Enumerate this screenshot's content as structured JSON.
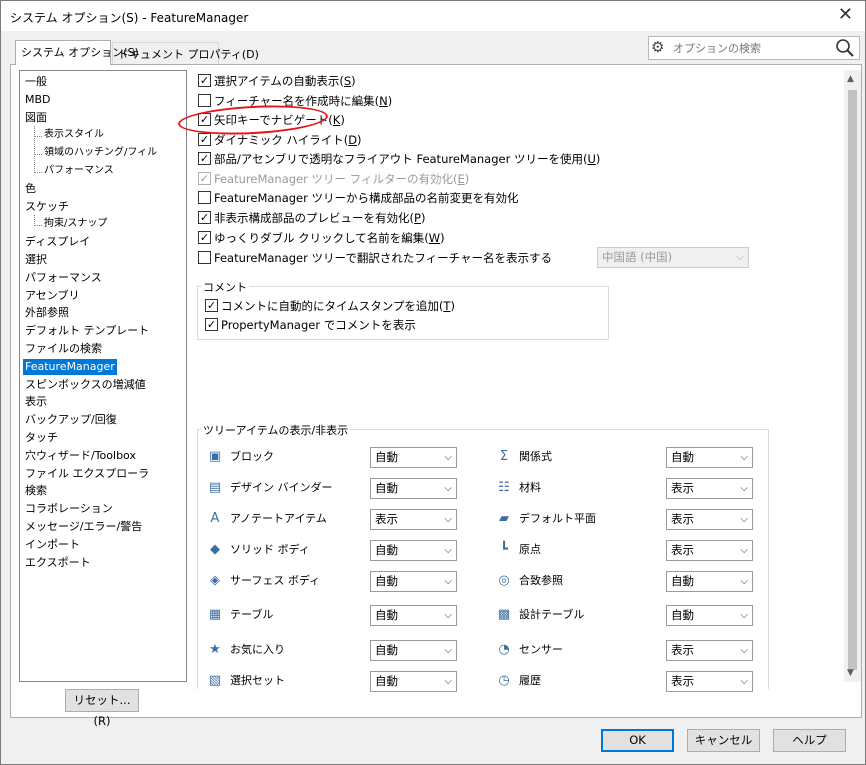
{
  "window": {
    "title": "システム オプション(S) - FeatureManager",
    "close_glyph": "✕"
  },
  "tabs": [
    {
      "label": "システム オプション(S)",
      "active": true
    },
    {
      "label": "ドキュメント プロパティ(D)",
      "active": false
    }
  ],
  "search": {
    "placeholder": "オプションの検索"
  },
  "tree": {
    "items": [
      {
        "label": "一般"
      },
      {
        "label": "MBD"
      },
      {
        "label": "図面"
      },
      {
        "label": "表示スタイル",
        "sub": true
      },
      {
        "label": "領域のハッチング/フィル",
        "sub": true
      },
      {
        "label": "パフォーマンス",
        "sub": true
      },
      {
        "label": "色"
      },
      {
        "label": "スケッチ"
      },
      {
        "label": "拘束/スナップ",
        "sub": true
      },
      {
        "label": "ディスプレイ"
      },
      {
        "label": "選択"
      },
      {
        "label": "パフォーマンス"
      },
      {
        "label": "アセンブリ"
      },
      {
        "label": "外部参照"
      },
      {
        "label": "デフォルト テンプレート"
      },
      {
        "label": "ファイルの検索"
      },
      {
        "label": "FeatureManager",
        "selected": true
      },
      {
        "label": "スピンボックスの増減値"
      },
      {
        "label": "表示"
      },
      {
        "label": "バックアップ/回復"
      },
      {
        "label": "タッチ"
      },
      {
        "label": "穴ウィザード/Toolbox"
      },
      {
        "label": "ファイル エクスプローラ"
      },
      {
        "label": "検索"
      },
      {
        "label": "コラボレーション"
      },
      {
        "label": "メッセージ/エラー/警告"
      },
      {
        "label": "インポート"
      },
      {
        "label": "エクスポート"
      }
    ]
  },
  "options": [
    {
      "label": "選択アイテムの自動表示(",
      "key": "S",
      "tail": ")",
      "checked": true
    },
    {
      "label": "フィーチャー名を作成時に編集(",
      "key": "N",
      "tail": ")",
      "checked": false
    },
    {
      "label": "矢印キーでナビゲート(",
      "key": "K",
      "tail": ")",
      "checked": true
    },
    {
      "label": "ダイナミック ハイライト(",
      "key": "D",
      "tail": ")",
      "checked": true
    },
    {
      "label": "部品/アセンブリで透明なフライアウト FeatureManager ツリーを使用(",
      "key": "U",
      "tail": ")",
      "checked": true
    },
    {
      "label": "FeatureManager ツリー フィルターの有効化(",
      "key": "E",
      "tail": ")",
      "checked": true,
      "disabled": true
    },
    {
      "label": "FeatureManager ツリーから構成部品の名前変更を有効化",
      "key": "",
      "tail": "",
      "checked": false
    },
    {
      "label": "非表示構成部品のプレビューを有効化(",
      "key": "P",
      "tail": ")",
      "checked": true
    },
    {
      "label": "ゆっくりダブル クリックして名前を編集(",
      "key": "W",
      "tail": ")",
      "checked": true
    },
    {
      "label": "FeatureManager ツリーで翻訳されたフィーチャー名を表示する",
      "key": "",
      "tail": "",
      "checked": false
    }
  ],
  "language_select": {
    "value": "中国語 (中国)",
    "disabled": true
  },
  "comment_group": {
    "title": "コメント",
    "options": [
      {
        "label": "コメントに自動的にタイムスタンプを追加(",
        "key": "T",
        "tail": ")",
        "checked": true
      },
      {
        "label": "PropertyManager でコメントを表示",
        "key": "",
        "tail": "",
        "checked": true
      }
    ]
  },
  "tree_items_group": {
    "title": "ツリーアイテムの表示/非表示",
    "left": [
      {
        "label": "ブロック",
        "value": "自動",
        "icon": "block-icon"
      },
      {
        "label": "デザイン バインダー",
        "value": "自動",
        "icon": "design-binder-icon"
      },
      {
        "label": "アノテートアイテム",
        "value": "表示",
        "icon": "annotation-icon"
      },
      {
        "label": "ソリッド ボディ",
        "value": "自動",
        "icon": "solid-body-icon"
      },
      {
        "label": "サーフェス ボディ",
        "value": "自動",
        "icon": "surface-body-icon"
      },
      {
        "label": "テーブル",
        "value": "自動",
        "icon": "table-icon"
      },
      {
        "label": "お気に入り",
        "value": "自動",
        "icon": "favorites-icon"
      },
      {
        "label": "選択セット",
        "value": "自動",
        "icon": "selection-set-icon"
      }
    ],
    "right": [
      {
        "label": "関係式",
        "value": "自動",
        "icon": "equations-icon"
      },
      {
        "label": "材料",
        "value": "表示",
        "icon": "material-icon"
      },
      {
        "label": "デフォルト平面",
        "value": "表示",
        "icon": "default-plane-icon"
      },
      {
        "label": "原点",
        "value": "表示",
        "icon": "origin-icon"
      },
      {
        "label": "合致参照",
        "value": "自動",
        "icon": "mate-reference-icon"
      },
      {
        "label": "設計テーブル",
        "value": "自動",
        "icon": "design-table-icon"
      },
      {
        "label": "センサー",
        "value": "表示",
        "icon": "sensor-icon"
      },
      {
        "label": "履歴",
        "value": "表示",
        "icon": "history-icon"
      }
    ]
  },
  "buttons": {
    "reset": "リセット...(R)",
    "ok": "OK",
    "cancel": "キャンセル",
    "help": "ヘルプ"
  },
  "colors": {
    "selection": "#0078d7",
    "annotation_ring": "#e8141b"
  }
}
